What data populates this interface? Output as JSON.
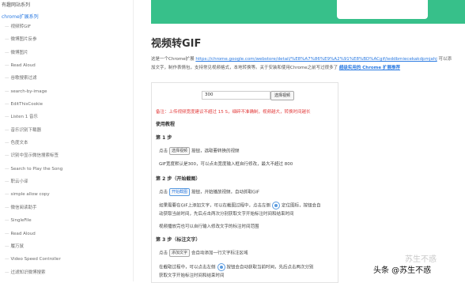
{
  "top_label": "有趣网站系列",
  "sidebar": {
    "category": "chrome扩展系列",
    "items": [
      "视频转GIF",
      "微博图片反参",
      "微博图片",
      "Read Aloud",
      "谷歌搜索过滤",
      "search-by-image",
      "EditThisCookie",
      "Listen 1 音乐",
      "音乐识别下载器",
      "色度文本",
      "识别中显示微信搜索标签",
      "Search to Play the Song",
      "职云小译",
      "simple allow copy",
      "微信阅读助手",
      "SingleFile",
      "Read Aloud",
      "履万鼠",
      "Video Speed Controller",
      "过滤知识微博搜索"
    ]
  },
  "article": {
    "title": "视频转GIF",
    "intro_prefix": "这是一个Chrome扩展",
    "intro_link": "https://chrome.google.com/webstore/detail/%E8%A7%86%E9%A2%91%E8%BD%ACgif/ieddbmiecekakdpmjahj",
    "intro_suffix": "可以添加文字，制作表情包，支持常见视频格式，本地转换等。关于安装和使用Chrome之前写过很多了",
    "intro_bold_link": "超级实用的 Chrome 扩展推荐"
  },
  "tool": {
    "input_value": "300",
    "convert_label": "选择视频",
    "warning": "备注：上传视频宽度建议不超过 15 S，细碎不准确制，视频越大，转换时间越长",
    "guide_heading": "使用教程",
    "step1_heading": "第 1 步",
    "step1_pre": "点击",
    "step1_btn": "选择视频",
    "step1_post": "按钮，选取要转换的视频",
    "step1_note": "GIF宽度默认是300，可以点击宽度输入框自行修改，最大不超过 800",
    "step2_heading": "第 2 步（开始截图）",
    "step2_pre": "点击",
    "step2_btn": "开始截图",
    "step2_post": "按钮，开始播放视频，自动抓取GIF",
    "step2_note_a": "如果需要在GIF上添加文字，可以在截图过程中，点击左侧",
    "step2_note_b": "定位图标，按钮会自",
    "step2_note_c": "动获取当前时间，先后点击两次分别获取文字开始标注时间和结束时间",
    "step2_note_d": "视频播放完也可以自行输入修改文字的标注时间范围",
    "step3_heading": "第 3 步（标注文字）",
    "step3_pre": "点击",
    "step3_btn": "添加文字",
    "step3_post": "会自动添加一行文字标注区域",
    "step3_note_a": "在截取过程中，可以点击左侧",
    "step3_note_b": "按钮会自动获取当前时间，先后点击两次分别",
    "step3_note_c": "获取文字开始标注时间和结束时间"
  },
  "watermark": {
    "text": "头条 @苏生不惑",
    "faint": "苏生不惑"
  }
}
